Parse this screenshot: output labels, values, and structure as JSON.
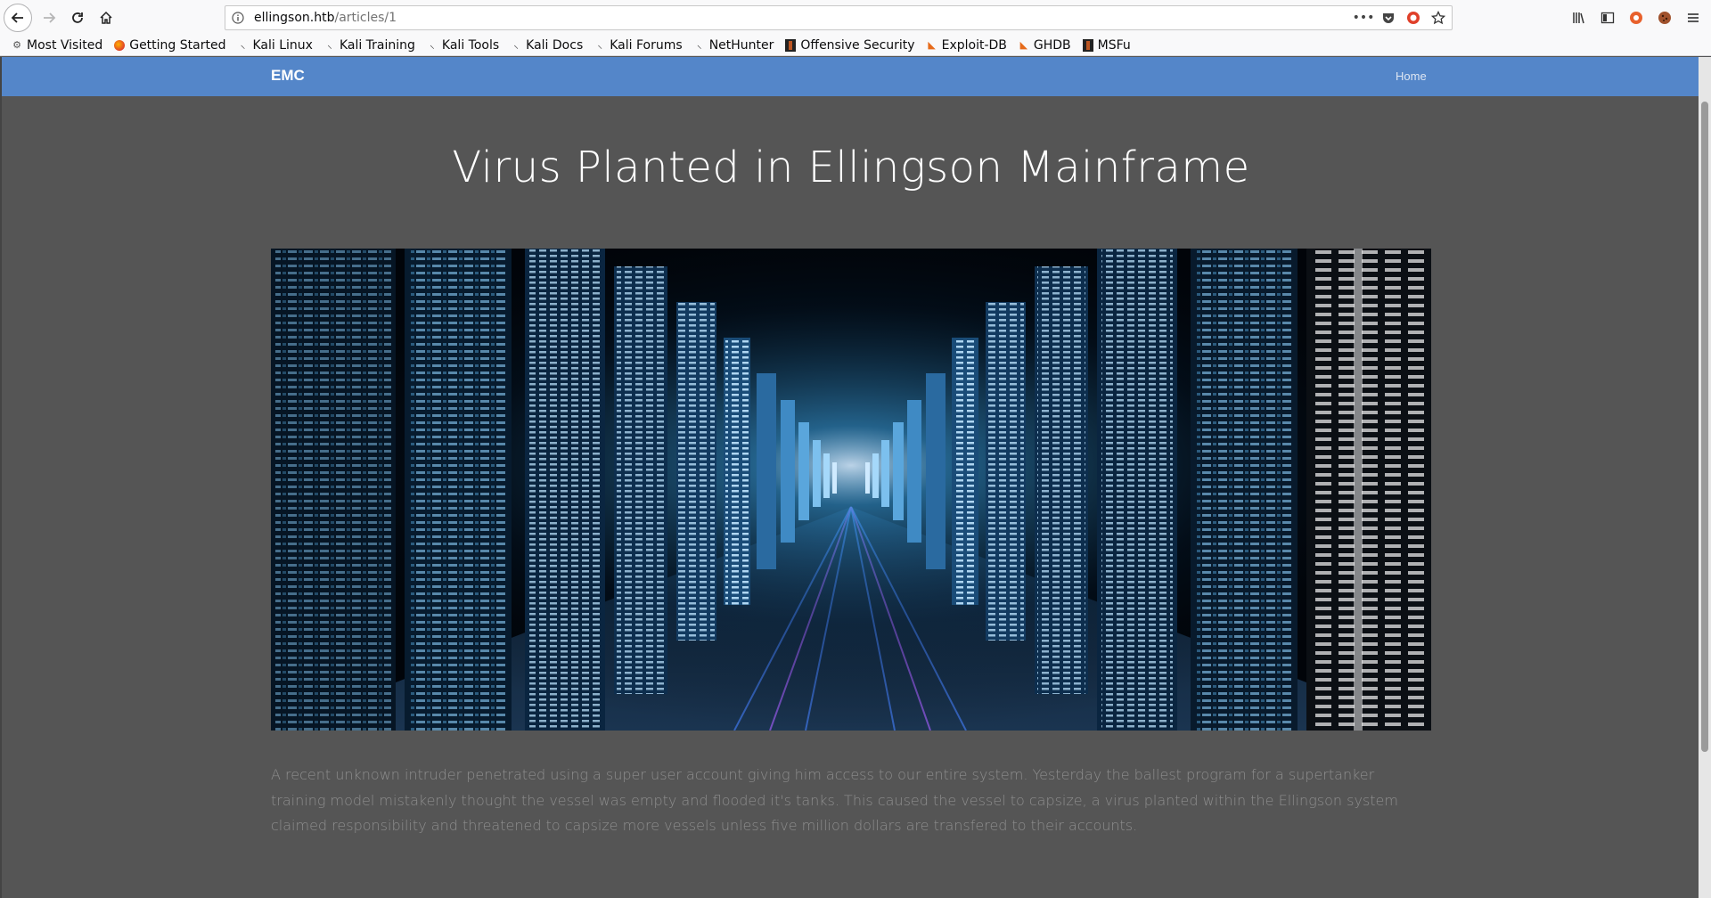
{
  "browser": {
    "url_host": "ellingson.htb",
    "url_path": "/articles/1",
    "bookmarks": [
      {
        "label": "Most Visited",
        "icon": "gear-icon"
      },
      {
        "label": "Getting Started",
        "icon": "firefox-icon"
      },
      {
        "label": "Kali Linux",
        "icon": "kali-dragon-icon"
      },
      {
        "label": "Kali Training",
        "icon": "kali-dragon-icon"
      },
      {
        "label": "Kali Tools",
        "icon": "kali-dragon-icon"
      },
      {
        "label": "Kali Docs",
        "icon": "kali-dragon-icon"
      },
      {
        "label": "Kali Forums",
        "icon": "kali-dragon-icon"
      },
      {
        "label": "NetHunter",
        "icon": "kali-dragon-icon"
      },
      {
        "label": "Offensive Security",
        "icon": "offsec-icon"
      },
      {
        "label": "Exploit-DB",
        "icon": "exploitdb-icon"
      },
      {
        "label": "GHDB",
        "icon": "exploitdb-icon"
      },
      {
        "label": "MSFu",
        "icon": "offsec-icon"
      }
    ]
  },
  "site": {
    "brand": "EMC",
    "nav_home": "Home",
    "navbar_color": "#5486c9",
    "background_color": "#555555"
  },
  "article": {
    "title": "Virus Planted in Ellingson Mainframe",
    "hero_image": "mainframe-data-corridor-image",
    "body": "A recent unknown intruder penetrated using a super user account giving him access to our entire system. Yesterday the ballest program for a supertanker training model mistakenly thought the vessel was empty and flooded it's tanks. This caused the vessel to capsize, a virus planted within the Ellingson system claimed responsibility and threatened to capsize more vessels unless five million dollars are transfered to their accounts."
  }
}
